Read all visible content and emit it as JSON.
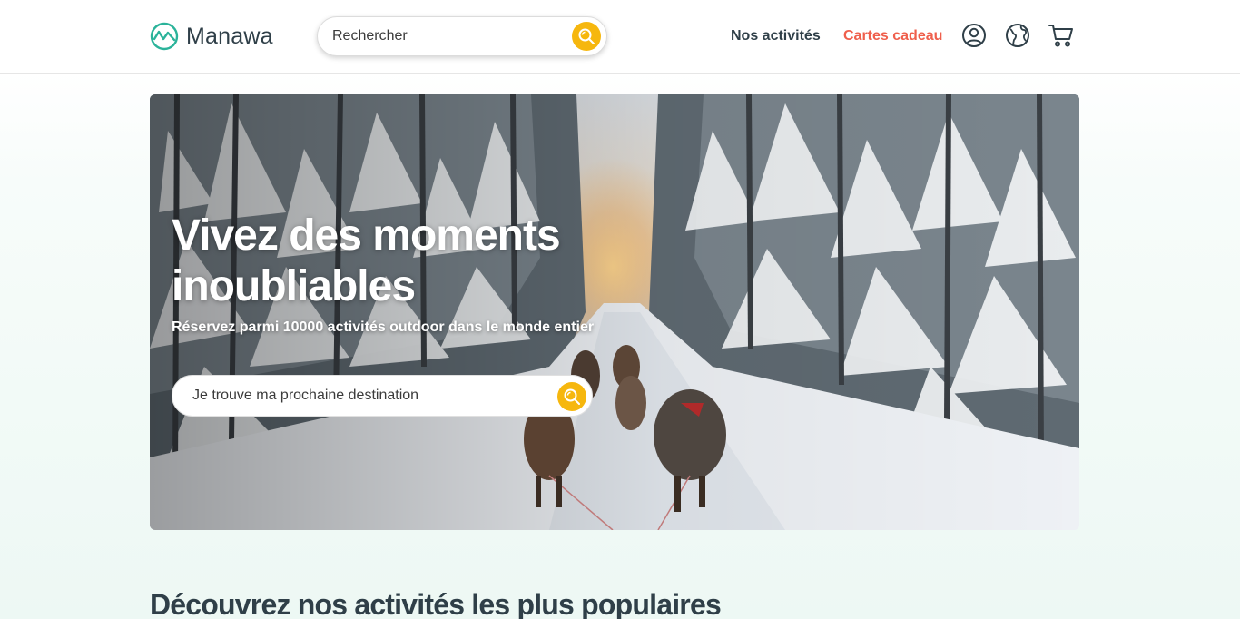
{
  "header": {
    "logo_text": "Manawa",
    "search_placeholder": "Rechercher",
    "nav": {
      "activities": "Nos activités",
      "gift_cards": "Cartes cadeau"
    },
    "icons": [
      "search-icon",
      "user-icon",
      "globe-icon",
      "cart-icon"
    ]
  },
  "hero": {
    "title": "Vivez des moments inoubliables",
    "subtitle": "Réservez parmi 10000 activités outdoor dans le monde entier",
    "search_placeholder": "Je trouve ma prochaine destination"
  },
  "popular": {
    "title": "Découvrez nos activités les plus populaires"
  },
  "colors": {
    "accent_yellow": "#f6b70e",
    "brand_teal": "#2bb39a",
    "gift_link": "#ef5f4c",
    "text_dark": "#2f3f48"
  }
}
